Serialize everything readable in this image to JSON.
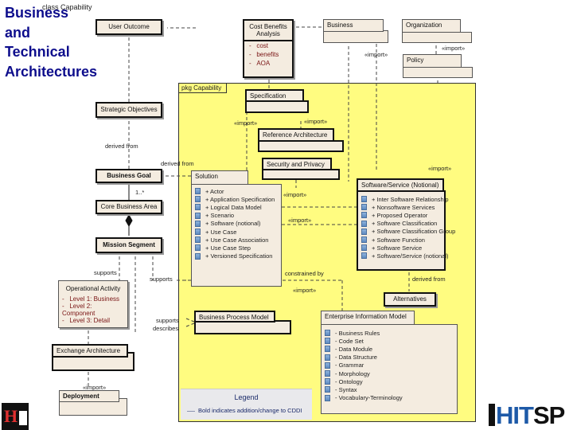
{
  "slide_title": "Business and Technical Architectures",
  "frame_label": "class Capability",
  "package_label": "pkg Capability",
  "classes": {
    "user_outcome": "User Outcome",
    "cost_benefits": {
      "name": "Cost Benefits Analysis",
      "attributes": [
        "cost",
        "benefits",
        "AOA"
      ],
      "attr_prefix": "-"
    },
    "strategic_objectives": "Strategic Objectives",
    "business_goal": "Business Goal",
    "core_business_area": "Core Business Area",
    "mission_segment": "Mission Segment",
    "operational_activity": {
      "name": "Operational Activity",
      "attributes": [
        "Level 1: Business",
        "Level 2: Component",
        "Level 3: Detail"
      ],
      "attr_prefix": "-"
    },
    "alternatives": "Alternatives"
  },
  "packages": {
    "business": "Business",
    "organization": "Organization",
    "policy": "Policy",
    "specification": "Specification",
    "reference_architecture": "Reference Architecture",
    "security_privacy": "Security and Privacy",
    "business_process_model": "Business Process Model",
    "exchange_architecture": "Exchange Architecture",
    "deployment": "Deployment"
  },
  "solution": {
    "name": "Solution",
    "items": [
      "+ Actor",
      "+ Application Specification",
      "+ Logical Data Model",
      "+ Scenario",
      "+ Software (notional)",
      "+ Use Case",
      "+ Use Case Association",
      "+ Use Case Step",
      "+ Versioned Specification"
    ]
  },
  "software_service": {
    "name": "Software/Service (Notional)",
    "items": [
      "+ Inter Software Relationship",
      "+ Nonsoftware Services",
      "+ Proposed Operator",
      "+ Software Classification",
      "+ Software Classification Group",
      "+ Software Function",
      "+ Software Service",
      "+ Software/Service (notional)"
    ]
  },
  "enterprise_info_model": {
    "name": "Enterprise Information Model",
    "items": [
      "- Business Rules",
      "- Code Set",
      "- Data Module",
      "- Data Structure",
      "- Grammar",
      "- Morphology",
      "- Ontology",
      "- Syntax",
      "- Vocabulary-Terminology"
    ]
  },
  "relationship_labels": {
    "import": "«import»",
    "derived_from": "derived from",
    "multiplicity": "1..*",
    "supports": "supports",
    "describes": "describes",
    "constrained_by": "constrained by"
  },
  "legend": {
    "title": "Legend",
    "entry": "Bold indicates addition/change to CDDI"
  },
  "logos": {
    "hl7": "HL7",
    "hitsp_hit": "HIT",
    "hitsp_sp": "SP"
  },
  "colors": {
    "title": "#0d0d8c",
    "package_fill": "#fffc80",
    "class_fill": "#f4ece0",
    "attribute_text": "#7a1515",
    "hitsp_blue": "#1e5aa8"
  }
}
